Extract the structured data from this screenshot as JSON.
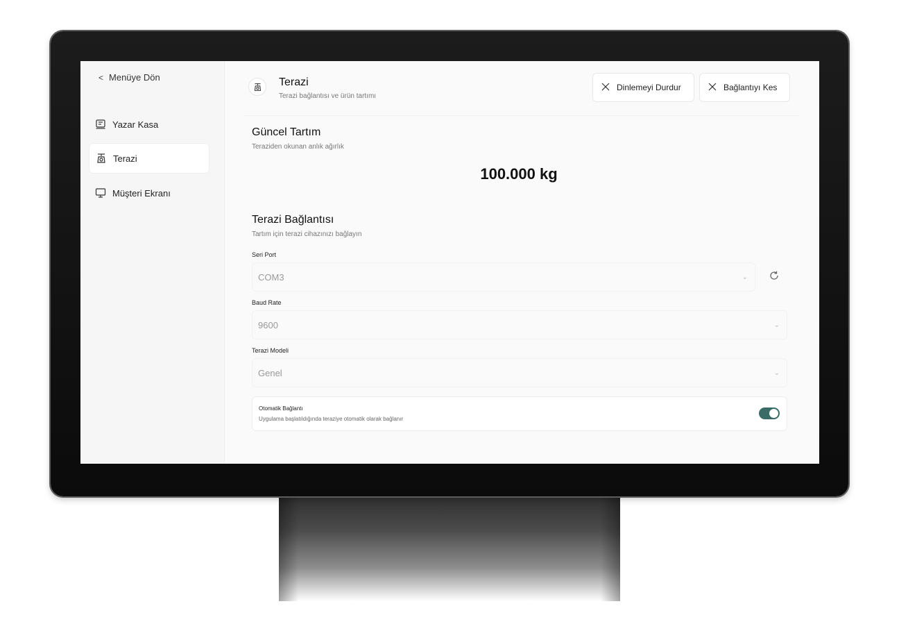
{
  "sidebar": {
    "back_label": "Menüye Dön",
    "items": [
      {
        "label": "Yazar Kasa",
        "icon": "register-icon",
        "active": false
      },
      {
        "label": "Terazi",
        "icon": "scale-icon",
        "active": true
      },
      {
        "label": "Müşteri Ekranı",
        "icon": "monitor-icon",
        "active": false
      }
    ]
  },
  "header": {
    "title": "Terazi",
    "subtitle": "Terazi bağlantısı ve ürün tartımı",
    "stop_listening_label": "Dinlemeyi Durdur",
    "disconnect_label": "Bağlantıyı Kes"
  },
  "current_weight": {
    "title": "Güncel Tartım",
    "subtitle": "Teraziden okunan anlık ağırlık",
    "value": "100.000 kg"
  },
  "connection": {
    "title": "Terazi Bağlantısı",
    "subtitle": "Tartım için terazi cihazınızı bağlayın",
    "serial_port": {
      "label": "Seri Port",
      "value": "COM3"
    },
    "baud_rate": {
      "label": "Baud Rate",
      "value": "9600"
    },
    "scale_model": {
      "label": "Terazi Modeli",
      "value": "Genel"
    },
    "auto_connect": {
      "title": "Otomatik Bağlantı",
      "description": "Uygulama başlatıldığında teraziye otomatik olarak bağlanır",
      "enabled": true
    }
  },
  "colors": {
    "accent": "#3a6b66"
  }
}
